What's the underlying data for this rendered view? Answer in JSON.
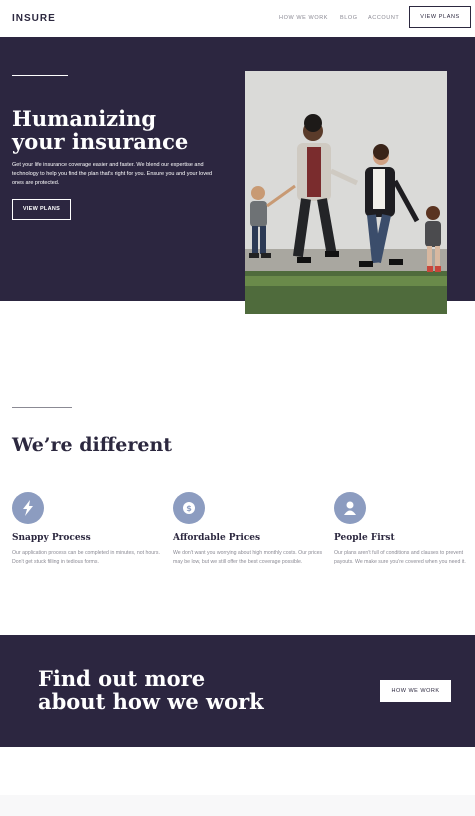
{
  "header": {
    "logo": "INSURE",
    "nav": [
      "HOW WE WORK",
      "BLOG",
      "ACCOUNT"
    ],
    "cta_label": "VIEW PLANS"
  },
  "hero": {
    "title_line1": "Humanizing",
    "title_line2": "your insurance",
    "text": "Get your life insurance coverage easier and faster. We blend our expertise and technology to help you find the plan that's right for you. Ensure you and your loved ones are protected.",
    "button_label": "VIEW PLANS"
  },
  "different": {
    "title": "We’re different",
    "features": [
      {
        "icon": "lightning-icon",
        "title": "Snappy Process",
        "text": "Our application process can be completed in minutes, not hours. Don't get stuck filling in tedious forms."
      },
      {
        "icon": "dollar-icon",
        "title": "Affordable Prices",
        "text": "We don't want you worrying about high monthly costs. Our prices may be low, but we still offer the best coverage possible."
      },
      {
        "icon": "person-icon",
        "title": "People First",
        "text": "Our plans aren't full of conditions and clauses to prevent payouts. We make sure you're covered when you need it."
      }
    ]
  },
  "cta": {
    "title_line1": "Find out more",
    "title_line2": "about how we work",
    "button_label": "HOW WE WORK"
  },
  "colors": {
    "dark_violet": "#2c2640",
    "icon_blue": "#8c9cc0",
    "grey_text": "#8b8a94"
  }
}
